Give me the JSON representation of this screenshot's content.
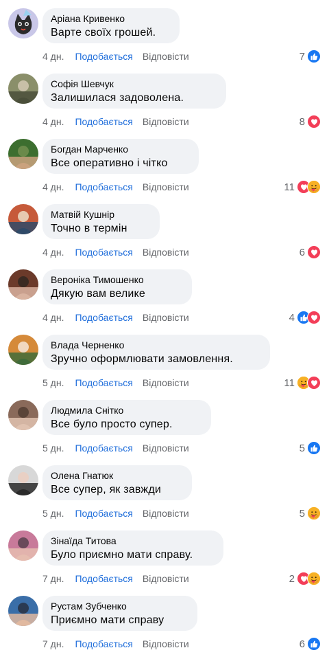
{
  "actions": {
    "like_label": "Подобається",
    "reply_label": "Відповісти"
  },
  "colors": {
    "bubble": "#f0f2f5",
    "like_link": "#216fdb",
    "meta": "#65676b",
    "like_icon": "#1877f2",
    "love_icon": "#f33e58",
    "care_icon": "#f7b125"
  },
  "comments": [
    {
      "author": "Аріана Кривенко",
      "text": "Варте своїх грошей.",
      "time": "4 дн.",
      "count": "7",
      "reactions": [
        "like-icon"
      ],
      "avatar": "cat-avatar"
    },
    {
      "author": "Софія Шевчук",
      "text": "Залишилася задоволена.",
      "time": "4 дн.",
      "count": "8",
      "reactions": [
        "love-icon"
      ],
      "avatar": "photo-avatar"
    },
    {
      "author": "Богдан Марченко",
      "text": "Все оперативно і чітко",
      "time": "4 дн.",
      "count": "11",
      "reactions": [
        "love-icon",
        "care-icon"
      ],
      "avatar": "photo-avatar"
    },
    {
      "author": "Матвій Кушнір",
      "text": "Точно в термін",
      "time": "4 дн.",
      "count": "6",
      "reactions": [
        "love-icon"
      ],
      "avatar": "photo-avatar"
    },
    {
      "author": "Вероніка Тимошенко",
      "text": "Дякую вам велике",
      "time": "4 дн.",
      "count": "4",
      "reactions": [
        "like-icon",
        "love-icon"
      ],
      "avatar": "photo-avatar"
    },
    {
      "author": "Влада Черненко",
      "text": "Зручно оформлювати замовлення.",
      "time": "5 дн.",
      "count": "11",
      "reactions": [
        "care-icon",
        "love-icon"
      ],
      "avatar": "photo-avatar"
    },
    {
      "author": "Людмила Снітко",
      "text": "Все було просто супер.",
      "time": "5 дн.",
      "count": "5",
      "reactions": [
        "like-icon"
      ],
      "avatar": "photo-avatar"
    },
    {
      "author": "Олена Гнатюк",
      "text": "Все супер, як завжди",
      "time": "5 дн.",
      "count": "5",
      "reactions": [
        "care-icon"
      ],
      "avatar": "photo-avatar"
    },
    {
      "author": "Зінаїда Титова",
      "text": "Було приємно мати справу.",
      "time": "7 дн.",
      "count": "2",
      "reactions": [
        "love-icon",
        "care-icon"
      ],
      "avatar": "photo-avatar"
    },
    {
      "author": "Рустам Зубченко",
      "text": "Приємно мати справу",
      "time": "7 дн.",
      "count": "6",
      "reactions": [
        "like-icon"
      ],
      "avatar": "photo-avatar"
    }
  ]
}
